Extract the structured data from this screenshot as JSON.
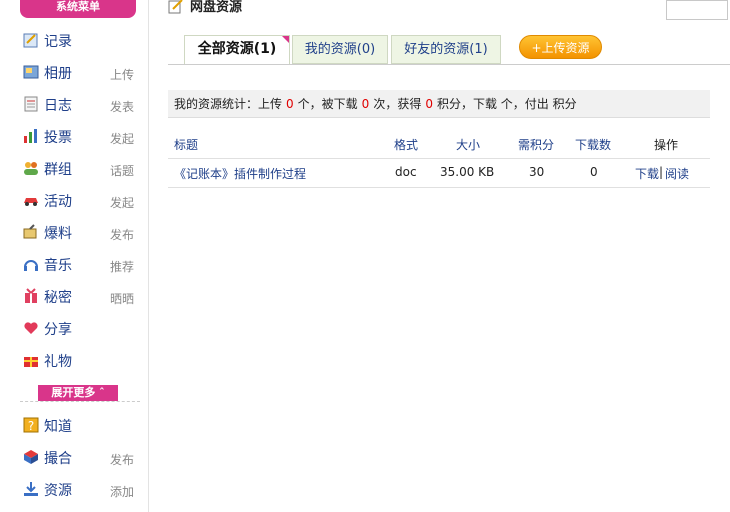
{
  "sidebar": {
    "header": "系统菜单",
    "items": [
      {
        "icon": "notepad-icon",
        "label": "记录",
        "action": ""
      },
      {
        "icon": "photo-album-icon",
        "label": "相册",
        "action": "上传"
      },
      {
        "icon": "diary-icon",
        "label": "日志",
        "action": "发表"
      },
      {
        "icon": "poll-chart-icon",
        "label": "投票",
        "action": "发起"
      },
      {
        "icon": "group-people-icon",
        "label": "群组",
        "action": "话题"
      },
      {
        "icon": "car-icon",
        "label": "活动",
        "action": "发起"
      },
      {
        "icon": "broadcast-icon",
        "label": "爆料",
        "action": "发布"
      },
      {
        "icon": "headphones-icon",
        "label": "音乐",
        "action": "推荐"
      },
      {
        "icon": "secret-gift-icon",
        "label": "秘密",
        "action": "晒晒"
      },
      {
        "icon": "share-hearts-icon",
        "label": "分享",
        "action": ""
      },
      {
        "icon": "gift-box-icon",
        "label": "礼物",
        "action": ""
      }
    ],
    "more_label": "展开更多",
    "extra_items": [
      {
        "icon": "question-icon",
        "label": "知道",
        "action": ""
      },
      {
        "icon": "cube-icon",
        "label": "撮合",
        "action": "发布"
      },
      {
        "icon": "download-icon",
        "label": "资源",
        "action": "添加"
      }
    ]
  },
  "main": {
    "title": "网盘资源",
    "tabs": [
      {
        "label": "全部资源(1)",
        "active": true
      },
      {
        "label": "我的资源(0)",
        "active": false
      },
      {
        "label": "好友的资源(1)",
        "active": false
      }
    ],
    "upload_button": "+上传资源",
    "stats": {
      "prefix": "我的资源统计：上传",
      "uploads": "0",
      "t1": "个，被下载",
      "downloads": "0",
      "t2": "次，获得",
      "points": "0",
      "t3": "积分，下载 个，付出 积分"
    },
    "table": {
      "headers": [
        "标题",
        "格式",
        "大小",
        "需积分",
        "下载数",
        "操作"
      ],
      "rows": [
        {
          "title": "《记账本》插件制作过程",
          "format": "doc",
          "size": "35.00 KB",
          "points": "30",
          "downloads": "0",
          "op_download": "下载",
          "op_sep": "|",
          "op_read": "阅读"
        }
      ]
    }
  }
}
